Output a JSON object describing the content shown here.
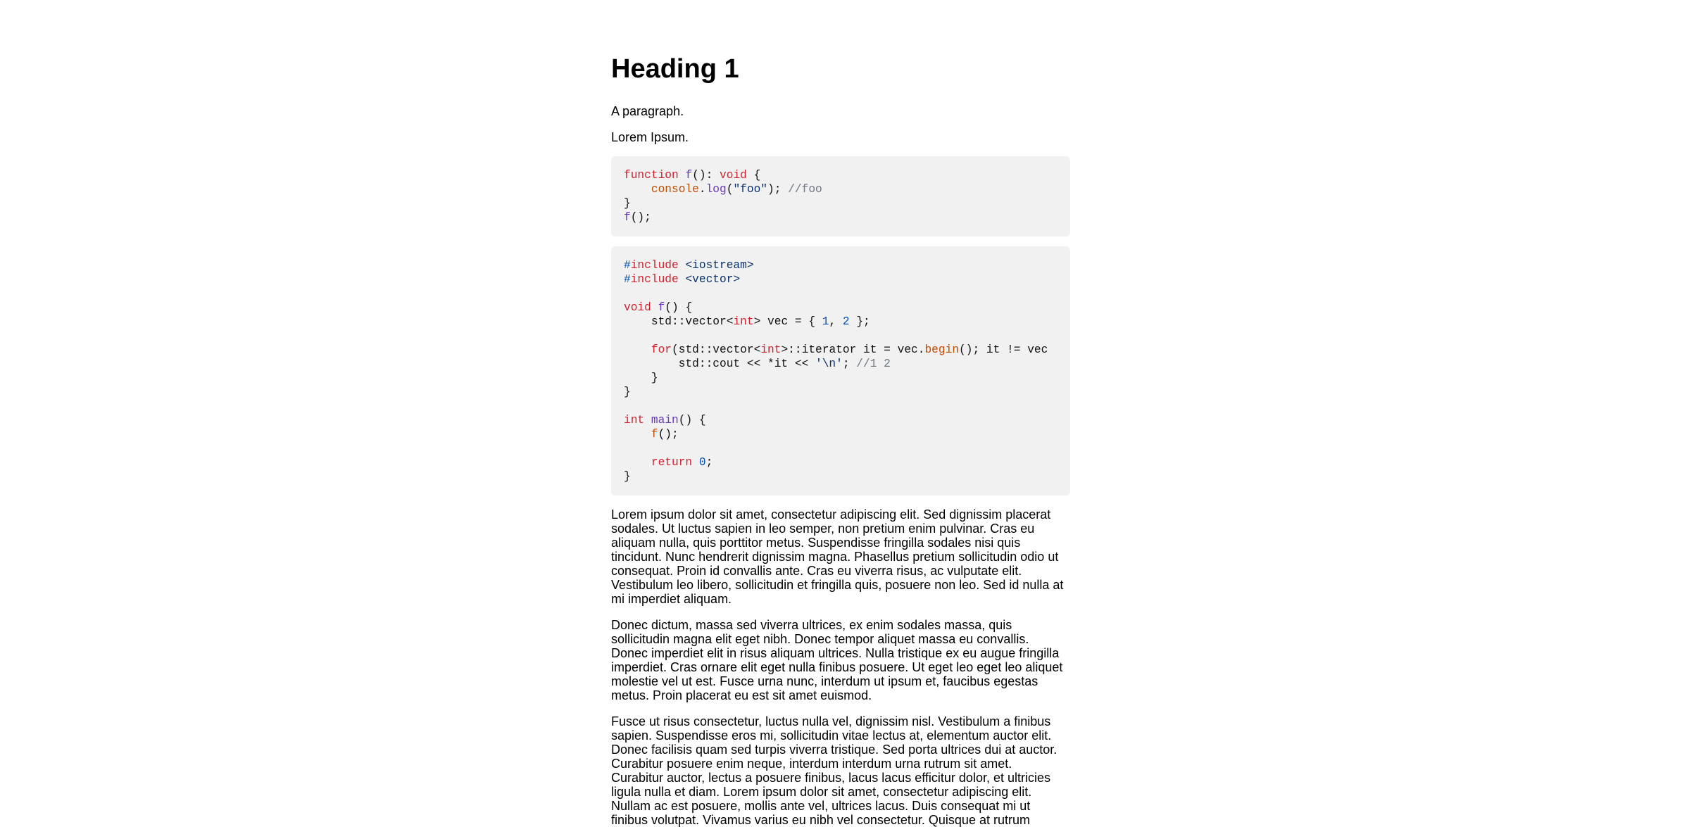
{
  "heading": "Heading 1",
  "paragraphs_short": [
    "A paragraph.",
    "Lorem Ipsum."
  ],
  "code_blocks": [
    {
      "lines": [
        [
          [
            "kw",
            "function"
          ],
          [
            "pl",
            " "
          ],
          [
            "fn",
            "f"
          ],
          [
            "pl",
            "(): "
          ],
          [
            "kw",
            "void"
          ],
          [
            "pl",
            " {"
          ]
        ],
        [
          [
            "pl",
            "    "
          ],
          [
            "fnor",
            "console"
          ],
          [
            "pl",
            "."
          ],
          [
            "fn",
            "log"
          ],
          [
            "pl",
            "("
          ],
          [
            "str",
            "\"foo\""
          ],
          [
            "pl",
            "); "
          ],
          [
            "cm",
            "//foo"
          ]
        ],
        [
          [
            "pl",
            "}"
          ]
        ],
        [
          [
            "fn",
            "f"
          ],
          [
            "pl",
            "();"
          ]
        ]
      ]
    },
    {
      "lines": [
        [
          [
            "inc",
            "#"
          ],
          [
            "kw",
            "include"
          ],
          [
            "pl",
            " "
          ],
          [
            "str",
            "<iostream>"
          ]
        ],
        [
          [
            "inc",
            "#"
          ],
          [
            "kw",
            "include"
          ],
          [
            "pl",
            " "
          ],
          [
            "str",
            "<vector>"
          ]
        ],
        [
          [
            "pl",
            ""
          ]
        ],
        [
          [
            "kw",
            "void"
          ],
          [
            "pl",
            " "
          ],
          [
            "fn",
            "f"
          ],
          [
            "pl",
            "() {"
          ]
        ],
        [
          [
            "pl",
            "    std::vector<"
          ],
          [
            "kw",
            "int"
          ],
          [
            "pl",
            "> vec = { "
          ],
          [
            "num",
            "1"
          ],
          [
            "pl",
            ", "
          ],
          [
            "num",
            "2"
          ],
          [
            "pl",
            " };"
          ]
        ],
        [
          [
            "pl",
            ""
          ]
        ],
        [
          [
            "pl",
            "    "
          ],
          [
            "kw",
            "for"
          ],
          [
            "pl",
            "(std::vector<"
          ],
          [
            "kw",
            "int"
          ],
          [
            "pl",
            ">::iterator it = vec."
          ],
          [
            "fnor",
            "begin"
          ],
          [
            "pl",
            "(); it != vec"
          ]
        ],
        [
          [
            "pl",
            "        std::cout << *it << "
          ],
          [
            "str",
            "'\\n'"
          ],
          [
            "pl",
            "; "
          ],
          [
            "cm",
            "//1 2"
          ]
        ],
        [
          [
            "pl",
            "    }"
          ]
        ],
        [
          [
            "pl",
            "}"
          ]
        ],
        [
          [
            "pl",
            ""
          ]
        ],
        [
          [
            "kw",
            "int"
          ],
          [
            "pl",
            " "
          ],
          [
            "fn",
            "main"
          ],
          [
            "pl",
            "() {"
          ]
        ],
        [
          [
            "pl",
            "    "
          ],
          [
            "fnor",
            "f"
          ],
          [
            "pl",
            "();"
          ]
        ],
        [
          [
            "pl",
            ""
          ]
        ],
        [
          [
            "pl",
            "    "
          ],
          [
            "kw",
            "return"
          ],
          [
            "pl",
            " "
          ],
          [
            "num",
            "0"
          ],
          [
            "pl",
            ";"
          ]
        ],
        [
          [
            "pl",
            "}"
          ]
        ]
      ]
    }
  ],
  "prose": [
    [
      "Lorem ipsum dolor sit amet, consectetur adipiscing elit. Sed dignissim placerat",
      "sodales. Ut luctus sapien in leo semper, non pretium enim pulvinar. Cras eu",
      "aliquam nulla, quis porttitor metus. Suspendisse fringilla sodales nisi quis",
      "tincidunt. Nunc hendrerit dignissim magna. Phasellus pretium sollicitudin odio ut",
      "consequat. Proin id convallis ante. Cras eu viverra risus, ac vulputate elit.",
      "Vestibulum leo libero, sollicitudin et fringilla quis, posuere non leo. Sed id nulla at",
      "mi imperdiet aliquam."
    ],
    [
      "Donec dictum, massa sed viverra ultrices, ex enim sodales massa, quis",
      "sollicitudin magna elit eget nibh. Donec tempor aliquet massa eu convallis.",
      "Donec imperdiet elit in risus aliquam ultrices. Nulla tristique ex eu augue fringilla",
      "imperdiet. Cras ornare elit eget nulla finibus posuere. Ut eget leo eget leo aliquet",
      "molestie vel ut est. Fusce urna nunc, interdum ut ipsum et, faucibus egestas",
      "metus. Proin placerat eu est sit amet euismod."
    ],
    [
      "Fusce ut risus consectetur, luctus nulla vel, dignissim nisl. Vestibulum a finibus",
      "sapien. Suspendisse eros mi, sollicitudin vitae lectus at, elementum auctor elit.",
      "Donec facilisis quam sed turpis viverra tristique. Sed porta ultrices dui at auctor.",
      "Curabitur posuere enim neque, interdum interdum urna rutrum sit amet.",
      "Curabitur auctor, lectus a posuere finibus, lacus lacus efficitur dolor, et ultricies",
      "ligula nulla et diam. Lorem ipsum dolor sit amet, consectetur adipiscing elit.",
      "Nullam ac est posuere, mollis ante vel, ultrices lacus. Duis consequat mi ut",
      "finibus volutpat. Vivamus varius eu nibh vel consectetur. Quisque at rutrum"
    ]
  ]
}
